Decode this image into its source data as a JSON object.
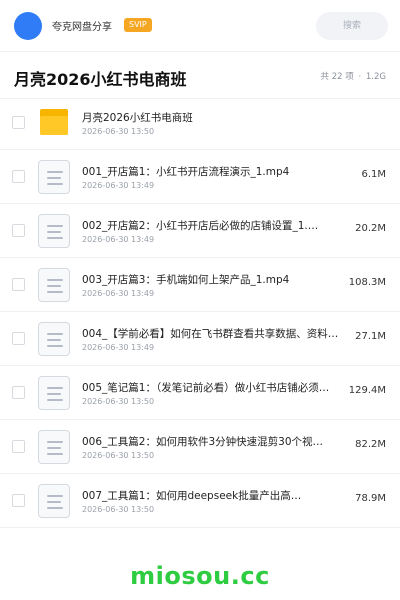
{
  "header": {
    "brand": "夸克网盘分享",
    "badge": "SVIP",
    "search_placeholder": "搜索"
  },
  "folder": {
    "title": "月亮2026小红书电商班",
    "count_text": "共 22 项",
    "separator": "·",
    "total_size": "1.2G"
  },
  "items": [
    {
      "type": "folder",
      "icon": "folder-icon",
      "name": "月亮2026小红书电商班",
      "date": "2026-06-30 13:50",
      "size": ""
    },
    {
      "type": "file",
      "icon": "file-icon",
      "name": "001_开店篇1：小红书开店流程演示_1.mp4",
      "date": "2026-06-30 13:49",
      "size": "6.1M"
    },
    {
      "type": "file",
      "icon": "file-icon",
      "name": "002_开店篇2：小红书开店后必做的店铺设置_1.…",
      "date": "2026-06-30 13:49",
      "size": "20.2M"
    },
    {
      "type": "file",
      "icon": "file-icon",
      "name": "003_开店篇3：手机端如何上架产品_1.mp4",
      "date": "2026-06-30 13:49",
      "size": "108.3M"
    },
    {
      "type": "file",
      "icon": "file-icon",
      "name": "004_【学前必看】如何在飞书群查看共享数据、资料…",
      "date": "2026-06-30 13:49",
      "size": "27.1M"
    },
    {
      "type": "file",
      "icon": "file-icon",
      "name": "005_笔记篇1：（发笔记前必看）做小红书店铺必须…",
      "date": "2026-06-30 13:50",
      "size": "129.4M"
    },
    {
      "type": "file",
      "icon": "file-icon",
      "name": "006_工具篇2：如何用软件3分钟快速混剪30个视…",
      "date": "2026-06-30 13:50",
      "size": "82.2M"
    },
    {
      "type": "file",
      "icon": "file-icon",
      "name": "007_工具篇1：如何用deepseek批量产出高…",
      "date": "2026-06-30 13:50",
      "size": "78.9M"
    }
  ],
  "watermark": "miosou.cc",
  "colors": {
    "accent_blue": "#2f7cf6",
    "svip_badge": "#f5a623",
    "folder_yellow": "#ffc826",
    "watermark_green": "#2ecc40"
  }
}
